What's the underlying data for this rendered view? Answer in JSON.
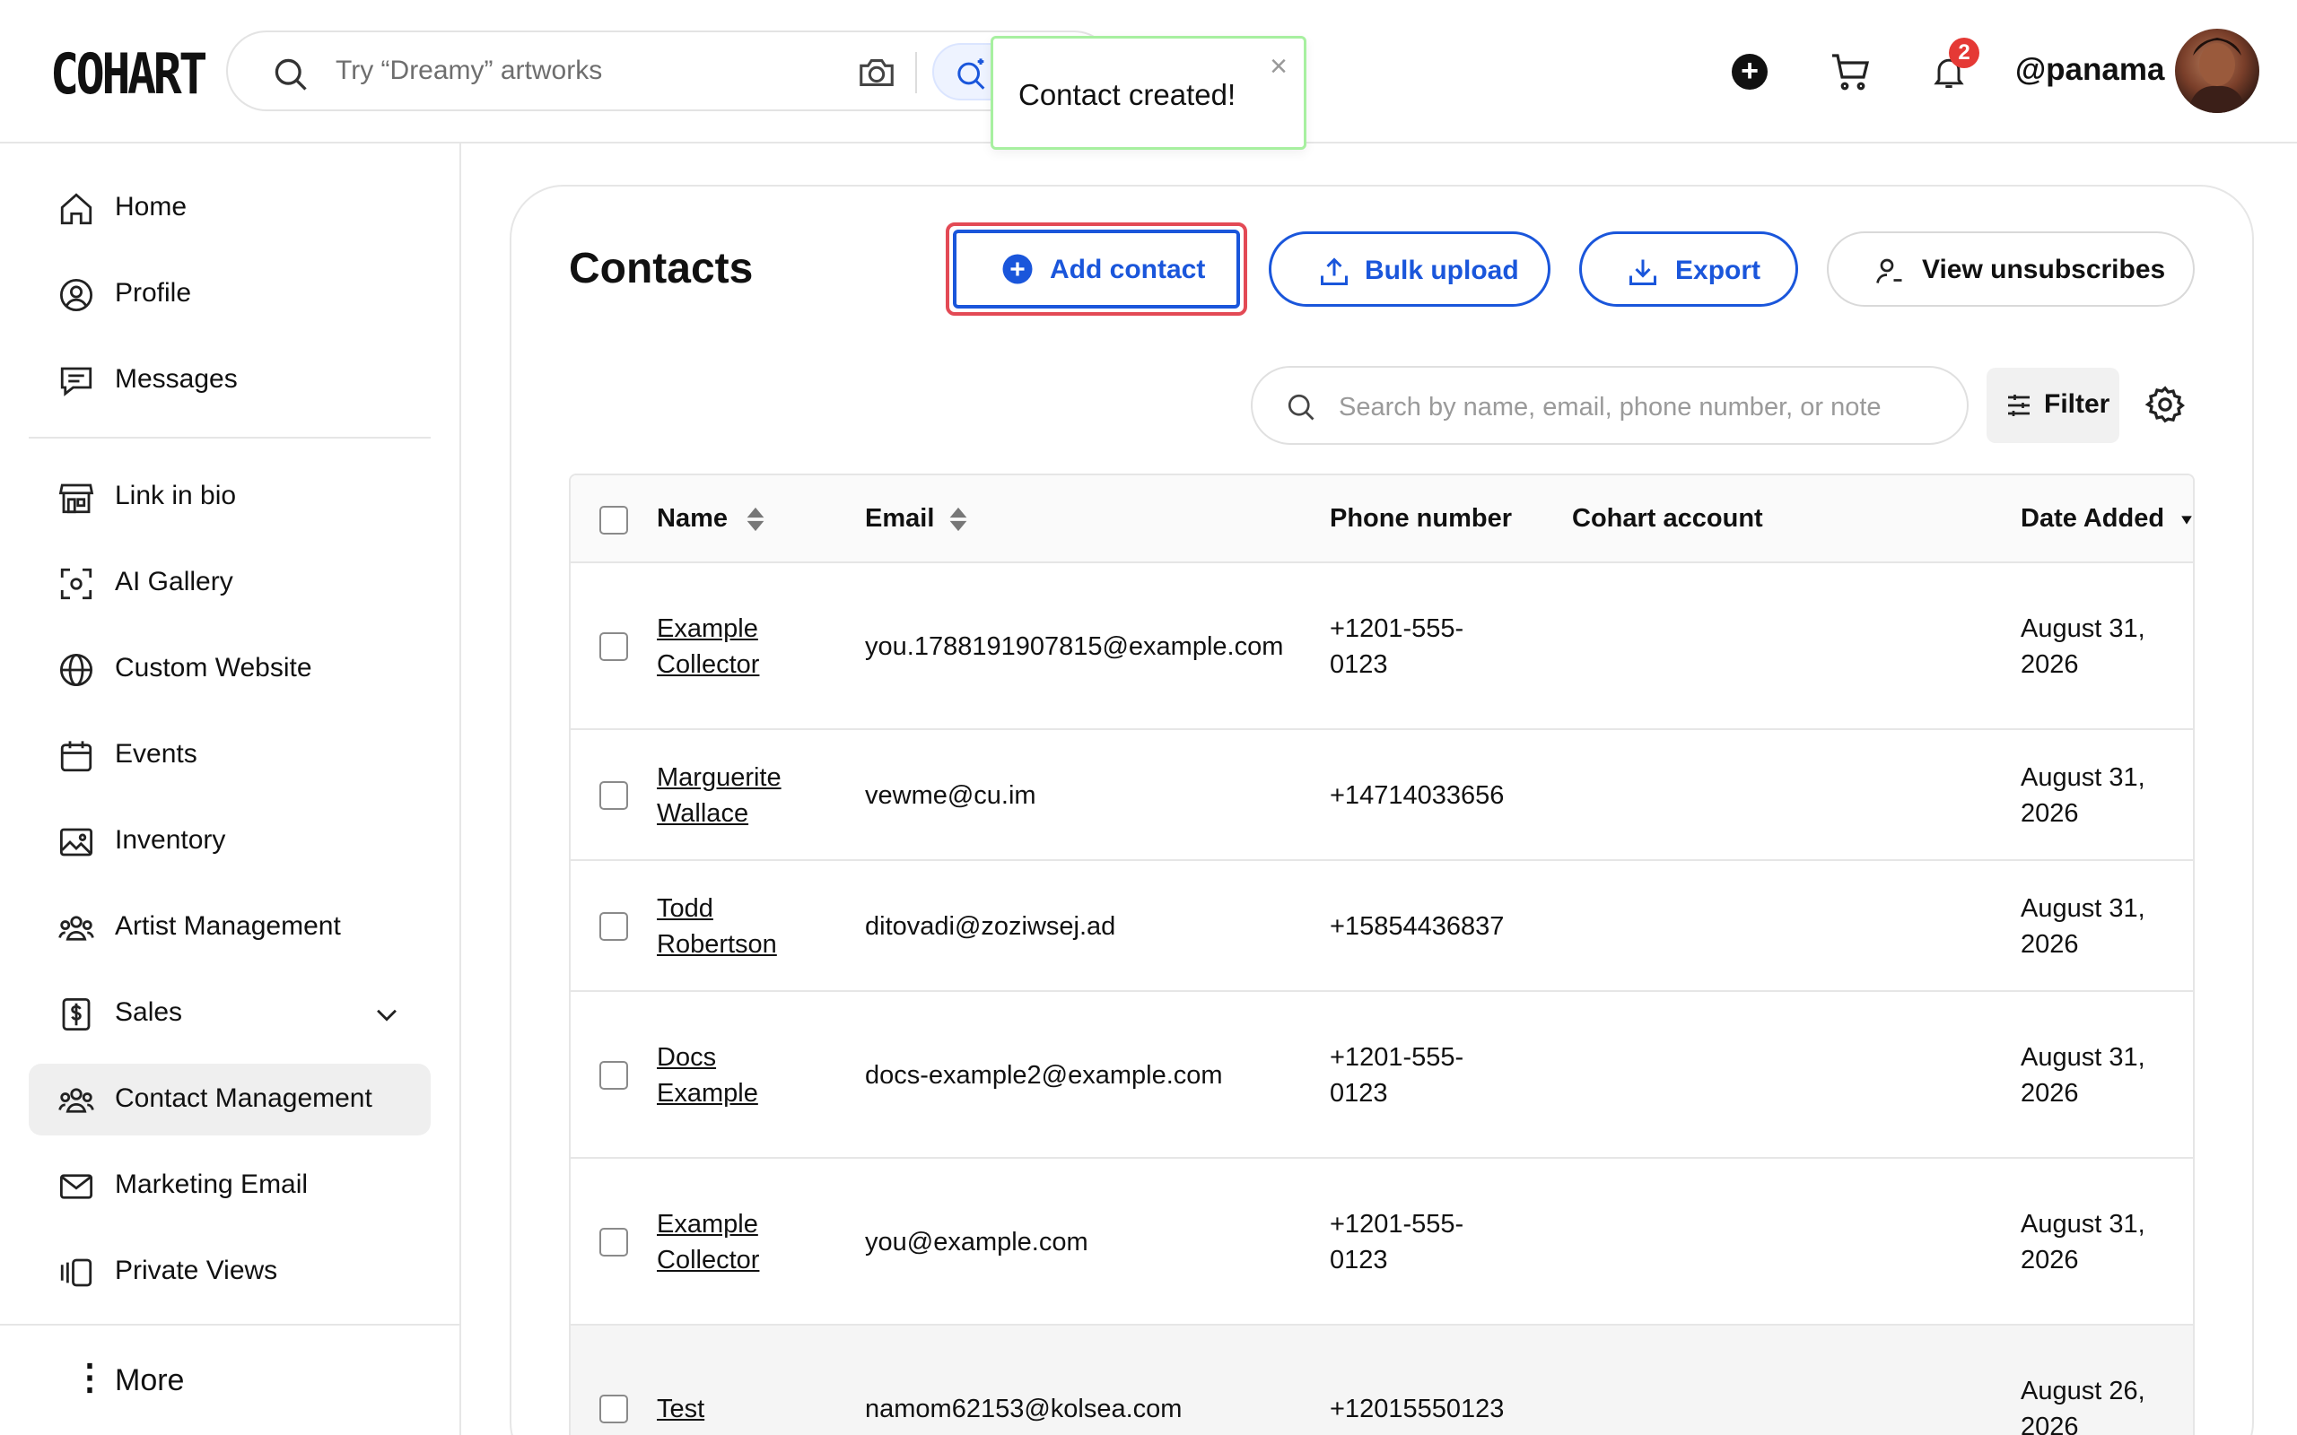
{
  "header": {
    "logo": "COHART",
    "search_placeholder": "Try “Dreamy” artworks",
    "notification_count": "2",
    "username": "@panama"
  },
  "toast": {
    "message": "Contact created!",
    "close": "×"
  },
  "sidebar": {
    "items": [
      {
        "label": "Home",
        "icon": "home-icon"
      },
      {
        "label": "Profile",
        "icon": "user-circle-icon"
      },
      {
        "label": "Messages",
        "icon": "chat-icon"
      },
      {
        "label": "Link in bio",
        "icon": "storefront-icon"
      },
      {
        "label": "AI Gallery",
        "icon": "scan-icon"
      },
      {
        "label": "Custom Website",
        "icon": "globe-icon"
      },
      {
        "label": "Events",
        "icon": "calendar-icon"
      },
      {
        "label": "Inventory",
        "icon": "image-icon"
      },
      {
        "label": "Artist Management",
        "icon": "users-icon"
      },
      {
        "label": "Sales",
        "icon": "dollar-icon"
      },
      {
        "label": "Contact Management",
        "icon": "users-icon"
      },
      {
        "label": "Marketing Email",
        "icon": "mail-icon"
      },
      {
        "label": "Private Views",
        "icon": "views-icon"
      }
    ],
    "active": "Contact Management",
    "more_label": "More"
  },
  "contacts": {
    "title": "Contacts",
    "add_label": "Add contact",
    "bulk_label": "Bulk upload",
    "export_label": "Export",
    "unsub_label": "View unsubscribes",
    "search_placeholder": "Search by name, email, phone number, or note",
    "filter_label": "Filter"
  },
  "table": {
    "columns": [
      "Name",
      "Email",
      "Phone number",
      "Cohart account",
      "Date Added"
    ],
    "rows": [
      {
        "name": "Example Collector",
        "email": "you.1788191907815@example.com",
        "phone": "+1201-555-0123",
        "cohart": "",
        "date": "August 31, 2026"
      },
      {
        "name": "Marguerite Wallace",
        "email": "vewme@cu.im",
        "phone": "+14714033656",
        "cohart": "",
        "date": "August 31, 2026"
      },
      {
        "name": "Todd Robertson",
        "email": "ditovadi@zoziwsej.ad",
        "phone": "+15854436837",
        "cohart": "",
        "date": "August 31, 2026"
      },
      {
        "name": "Docs Example",
        "email": "docs-example2@example.com",
        "phone": "+1201-555-0123",
        "cohart": "",
        "date": "August 31, 2026"
      },
      {
        "name": "Example Collector",
        "email": "you@example.com",
        "phone": "+1201-555-0123",
        "cohart": "",
        "date": "August 31, 2026"
      },
      {
        "name": "Test",
        "email": "namom62153@kolsea.com",
        "phone": "+12015550123",
        "cohart": "",
        "date": "August 26, 2026"
      }
    ]
  },
  "colors": {
    "accent": "#1a56db",
    "highlight": "#e34a55",
    "toast_border": "#a7f0a0",
    "badge": "#e53935"
  }
}
